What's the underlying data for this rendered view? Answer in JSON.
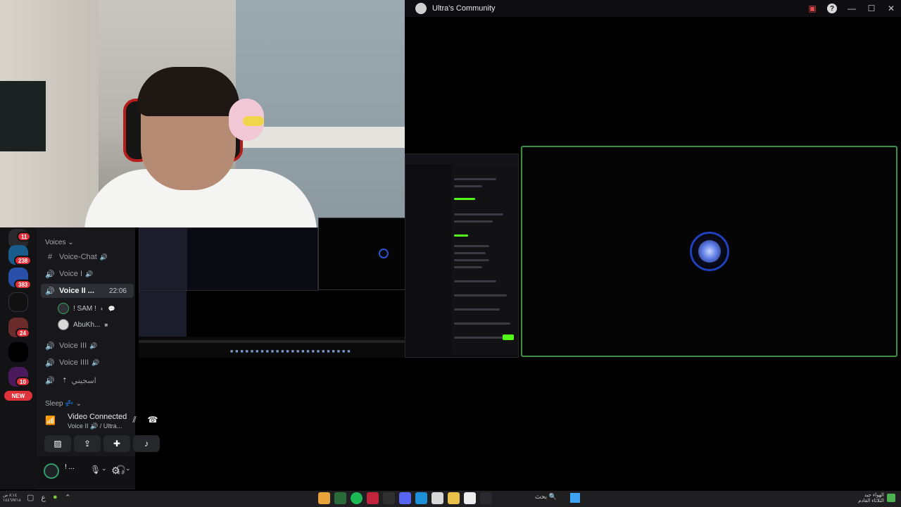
{
  "window": {
    "title": "Ultra's Community"
  },
  "servers": [
    {
      "badge": "11"
    },
    {
      "badge": "238"
    },
    {
      "badge": "383"
    },
    {
      "badge": ""
    },
    {
      "badge": "24"
    },
    {
      "badge": ""
    },
    {
      "badge": "10"
    }
  ],
  "new_label": "NEW",
  "channels": {
    "category_voices": "Voices",
    "items": [
      {
        "name": "Voice-Chat",
        "icon": "#"
      },
      {
        "name": "Voice I",
        "icon": "speaker"
      },
      {
        "name": "Voice II ...",
        "icon": "speaker",
        "time": "22:06"
      },
      {
        "name": "Voice III",
        "icon": "speaker"
      },
      {
        "name": "Voice IIII",
        "icon": "speaker"
      },
      {
        "name": "اسجيني",
        "icon": "speaker"
      }
    ],
    "users": [
      {
        "name": "! SAM !"
      },
      {
        "name": "AbuKh..."
      }
    ],
    "category_sleep": "Sleep"
  },
  "voice_panel": {
    "status": "Video Connected",
    "channel": "Voice II 🔊 / Ultra..."
  },
  "userbar": {
    "name": "! ..."
  },
  "taskbar": {
    "date_line1": "٨:١٤ ص",
    "date_line2": "١٤٤٦/٧/١٨",
    "search_text": "بحث",
    "weather_line1": "الهواء جيد",
    "weather_line2": "الثلاثاء القادم"
  },
  "stream_mid": {
    "label": ""
  },
  "colors": {
    "frame_green": "#3c8f45",
    "kick_green": "#53fc18",
    "badge_red": "#e0323a"
  }
}
